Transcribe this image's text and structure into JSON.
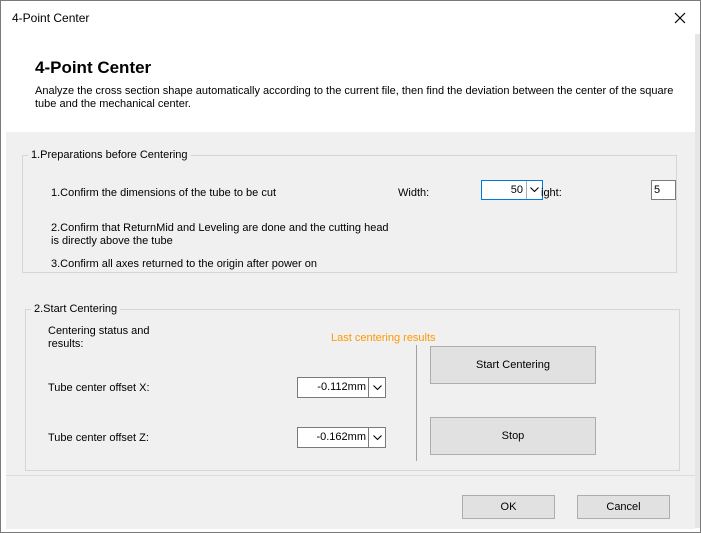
{
  "window": {
    "title": "4-Point Center"
  },
  "header": {
    "title": "4-Point Center",
    "description": "Analyze the cross section shape automatically according to the current file, then find the deviation between the center of the square tube and the mechanical center."
  },
  "prep": {
    "legend": "1.Preparations before Centering",
    "step1": "1.Confirm the dimensions of the tube to be cut",
    "width_label": "Width:",
    "width_value": "50",
    "height_label": "ight:",
    "height_value": "5",
    "step2": "2.Confirm that ReturnMid and Leveling are done and the cutting head is directly above the tube",
    "step3": "3.Confirm all axes returned to the origin after power on"
  },
  "centering": {
    "legend": "2.Start Centering",
    "status_label": "Centering status and results:",
    "last_results": "Last centering results",
    "offset_x_label": "Tube center offset X:",
    "offset_x_value": "-0.112mm",
    "offset_z_label": "Tube center offset Z:",
    "offset_z_value": "-0.162mm",
    "start_button": "Start Centering",
    "stop_button": "Stop"
  },
  "footer": {
    "ok_button": "OK",
    "cancel_button": "Cancel"
  },
  "colors": {
    "accent": "#0078d7",
    "last_results": "#ff9900",
    "panel": "#f0f0f0"
  }
}
